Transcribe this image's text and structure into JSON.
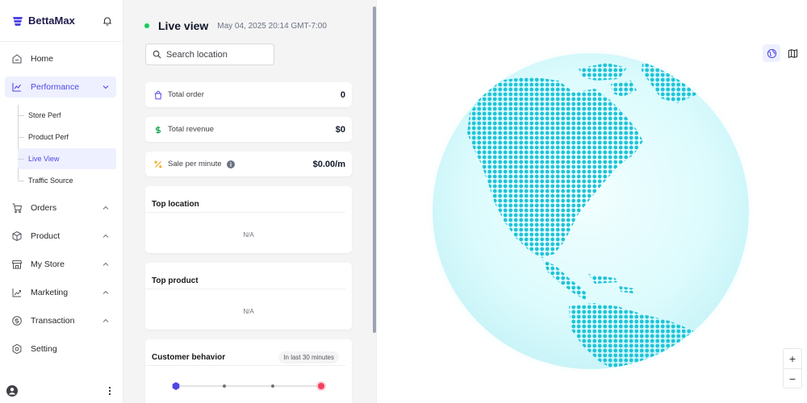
{
  "brand": {
    "name": "BettaMax",
    "icons": {
      "logo": "bettamax-logo",
      "bell": "bell-icon"
    }
  },
  "nav": [
    {
      "label": "Home",
      "icon": "home-icon",
      "has_chevron": false
    },
    {
      "label": "Performance",
      "icon": "chart-line-icon",
      "active": true,
      "expanded": true,
      "children": [
        {
          "label": "Store Perf"
        },
        {
          "label": "Product Perf"
        },
        {
          "label": "Live View",
          "active": true
        },
        {
          "label": "Traffic Source"
        }
      ]
    },
    {
      "label": "Orders",
      "icon": "cart-icon"
    },
    {
      "label": "Product",
      "icon": "box-icon"
    },
    {
      "label": "My Store",
      "icon": "store-icon"
    },
    {
      "label": "Marketing",
      "icon": "marketing-icon"
    },
    {
      "label": "Transaction",
      "icon": "transaction-icon"
    },
    {
      "label": "Setting",
      "icon": "gear-icon"
    }
  ],
  "live": {
    "title": "Live view",
    "timestamp": "May 04, 2025 20:14 GMT-7:00",
    "status_color": "#22c55e"
  },
  "search": {
    "placeholder": "Search location"
  },
  "metrics": [
    {
      "label": "Total order",
      "value": "0",
      "icon": "shopping-bag-icon"
    },
    {
      "label": "Total revenue",
      "value": "$0",
      "icon": "dollar-icon"
    },
    {
      "label": "Sale per minute",
      "value": "$0.00/m",
      "icon": "percent-icon",
      "info_icon": "info-icon"
    }
  ],
  "top_location": {
    "title": "Top location",
    "empty": "N/A"
  },
  "top_product": {
    "title": "Top product",
    "empty": "N/A"
  },
  "customer_behavior": {
    "title": "Customer behavior",
    "badge": "In last 30 minutes"
  },
  "map": {
    "view_toggle": [
      "globe-icon",
      "map-icon"
    ],
    "zoom_in": "+",
    "zoom_out": "−"
  },
  "colors": {
    "accent": "#4f46e5",
    "globe": "#d9fbfd",
    "land": "#22c7d9"
  }
}
